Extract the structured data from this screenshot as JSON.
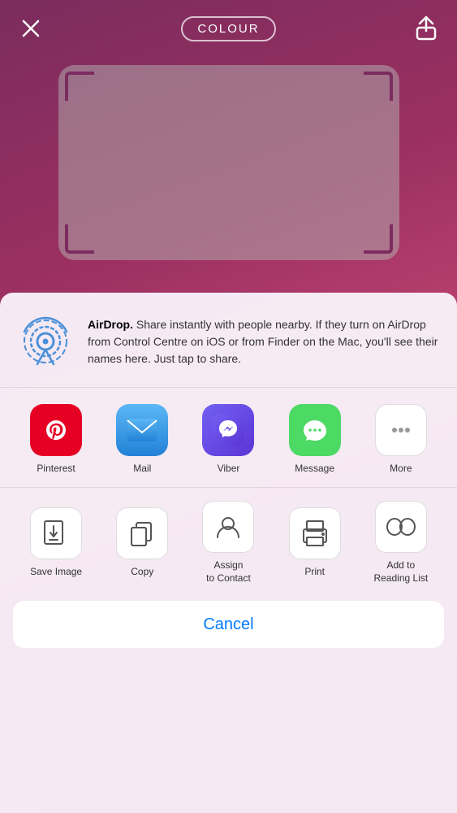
{
  "topbar": {
    "title": "COLOUR",
    "close_label": "×",
    "share_label": "share"
  },
  "airdrop": {
    "description_bold": "AirDrop.",
    "description": " Share instantly with people nearby. If they turn on AirDrop from Control Centre on iOS or from Finder on the Mac, you'll see their names here. Just tap to share."
  },
  "apps": [
    {
      "id": "pinterest",
      "label": "Pinterest"
    },
    {
      "id": "mail",
      "label": "Mail"
    },
    {
      "id": "viber",
      "label": "Viber"
    },
    {
      "id": "message",
      "label": "Message"
    },
    {
      "id": "more",
      "label": "More"
    }
  ],
  "actions": [
    {
      "id": "save-image",
      "label": "Save Image"
    },
    {
      "id": "copy",
      "label": "Copy"
    },
    {
      "id": "assign-contact",
      "label": "Assign\nto Contact"
    },
    {
      "id": "print",
      "label": "Print"
    },
    {
      "id": "reading-list",
      "label": "Add to\nReading List"
    }
  ],
  "cancel": {
    "label": "Cancel"
  }
}
